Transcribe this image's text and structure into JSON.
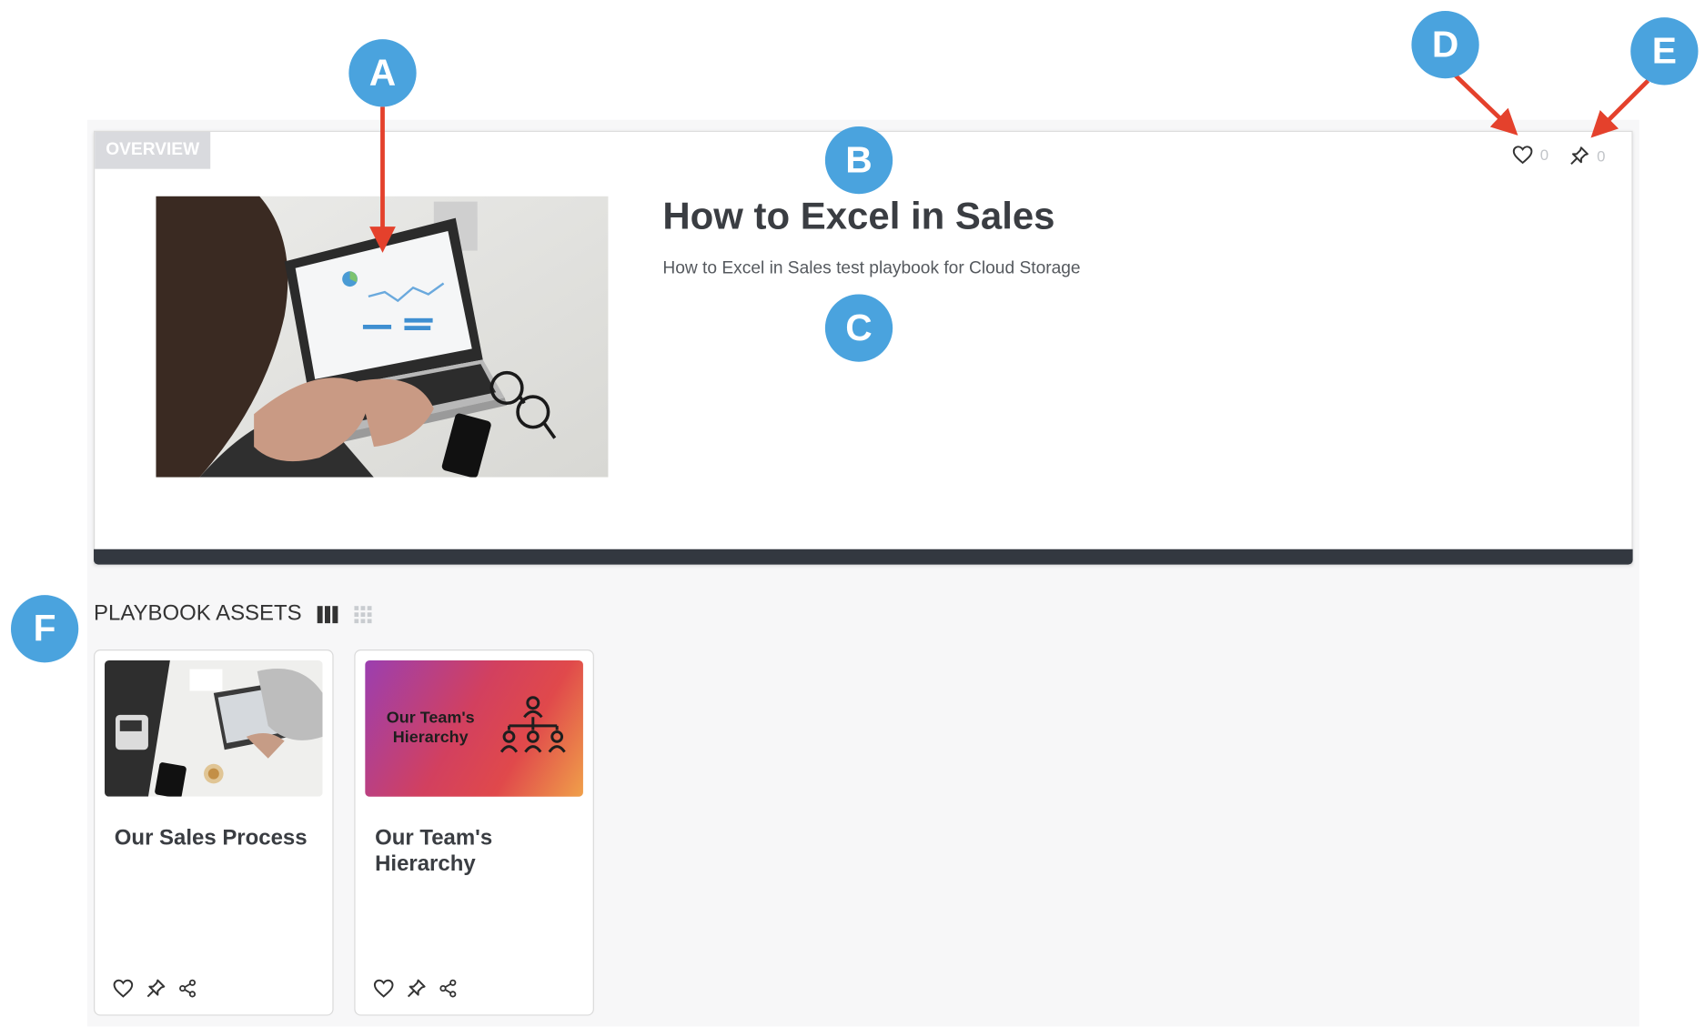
{
  "overview": {
    "tag": "OVERVIEW",
    "title": "How to Excel in Sales",
    "description": "How to Excel in Sales test playbook for Cloud Storage",
    "like_count": "0",
    "pin_count": "0"
  },
  "assets": {
    "section_title": "PLAYBOOK ASSETS",
    "items": [
      {
        "name": "Our Sales Process"
      },
      {
        "name": "Our Team's Hierarchy",
        "thumb_text": "Our Team's Hierarchy"
      }
    ]
  },
  "callouts": {
    "a": "A",
    "b": "B",
    "c": "C",
    "d": "D",
    "e": "E",
    "f": "F"
  },
  "colors": {
    "callout": "#4aa3de",
    "arrow": "#e4412c",
    "dark_bar": "#333840"
  },
  "icons": [
    "heart-icon",
    "pin-icon",
    "share-icon",
    "column-view-icon",
    "grid-view-icon"
  ]
}
